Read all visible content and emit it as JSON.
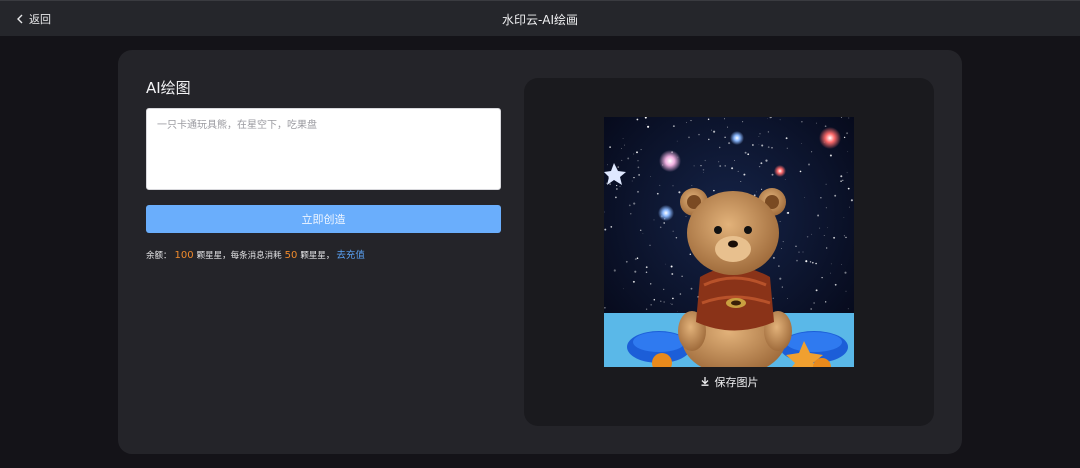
{
  "header": {
    "back_label": "返回",
    "title": "水印云-AI绘画"
  },
  "panel": {
    "section_title": "AI绘图",
    "prompt_placeholder": "一只卡通玩具熊，在星空下，吃果盘",
    "create_button": "立即创造",
    "balance": {
      "label": "余额：",
      "amount": "100",
      "unit_text": "颗星星，每条消息消耗",
      "cost": "50",
      "unit_text_2": "颗星星，",
      "recharge_link": "去充值"
    }
  },
  "result": {
    "image_alt": "卡通玩具熊星空图",
    "save_label": "保存图片"
  },
  "colors": {
    "accent_button": "#6aaefc",
    "highlight_number": "#f08a2c",
    "link": "#5aa2f5"
  },
  "icons": {
    "back": "chevron-left-icon",
    "save": "download-icon"
  }
}
